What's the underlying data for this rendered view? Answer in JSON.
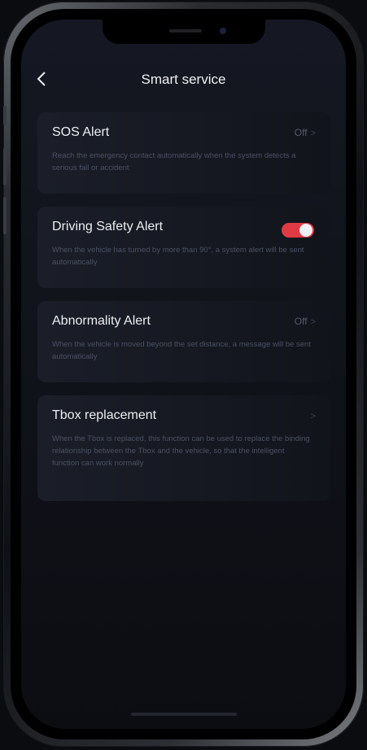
{
  "header": {
    "back_icon": "chevron-left-icon",
    "title": "Smart service"
  },
  "items": [
    {
      "title": "SOS Alert",
      "status": "Off",
      "description": "Reach the emergency contact automatically when the system detects a serious fall or accident"
    },
    {
      "title": "Driving Safety Alert",
      "toggle_on": true,
      "toggle_color": "#e03a44",
      "description": "When the vehicle has turned by more than 90°, a system alert will be sent automatically"
    },
    {
      "title": "Abnormality Alert",
      "status": "Off",
      "description": "When the vehicle is moved beyond the set distance, a message will be sent automatically"
    },
    {
      "title": "Tbox replacement",
      "description": "When the Tbox is replaced, this function can be used to replace the binding relationship between the Tbox and the vehicle, so that the intelligent function can work normally"
    }
  ]
}
